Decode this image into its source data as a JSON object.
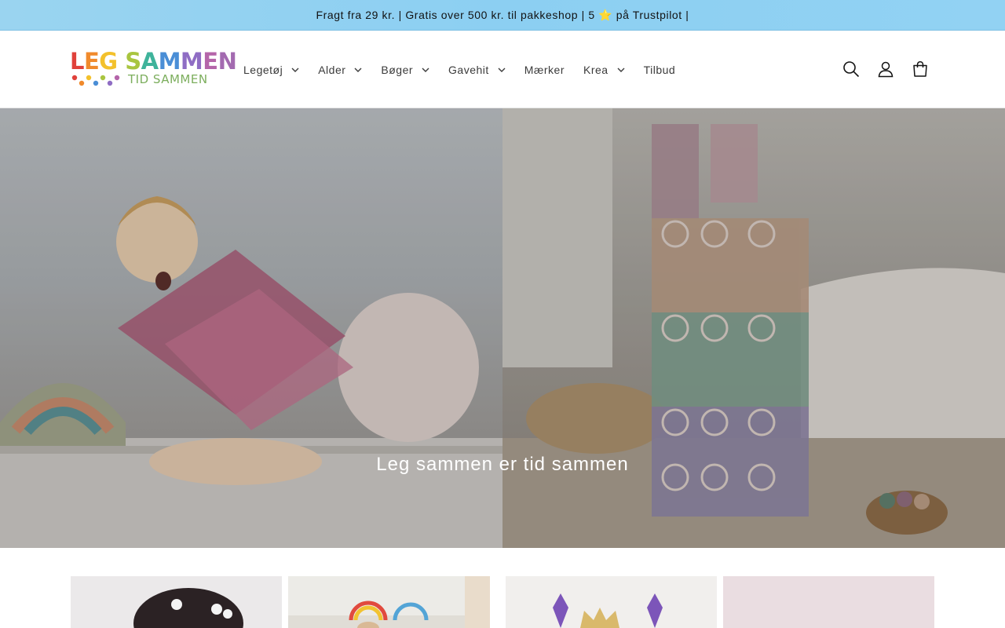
{
  "announcement": "Fragt fra 29 kr. | Gratis over 500 kr. til pakkeshop | 5 ⭐ på Trustpilot |",
  "logo": {
    "main": "LEG SAMMEN",
    "sub": "TID SAMMEN",
    "letter_colors": [
      "#e0413b",
      "#f08a2c",
      "#f3c12c",
      "#a9c540",
      "#3fb39b",
      "#4a8ed6",
      "#8f6dc4",
      "#b465a9",
      "#a36ab0",
      "#9b73b9"
    ]
  },
  "nav": {
    "items": [
      {
        "label": "Legetøj",
        "dropdown": true
      },
      {
        "label": "Alder",
        "dropdown": true
      },
      {
        "label": "Bøger",
        "dropdown": true
      },
      {
        "label": "Gavehit",
        "dropdown": true
      },
      {
        "label": "Mærker",
        "dropdown": false
      },
      {
        "label": "Krea",
        "dropdown": true
      },
      {
        "label": "Tilbud",
        "dropdown": false
      }
    ]
  },
  "header_icons": [
    "search-icon",
    "account-icon",
    "cart-icon"
  ],
  "hero": {
    "title": "Leg sammen er tid sammen"
  },
  "collections": {
    "count": 4
  },
  "colors": {
    "announcement_bg": "#8ccff2",
    "text": "#121212",
    "hero_text": "#ffffff"
  }
}
